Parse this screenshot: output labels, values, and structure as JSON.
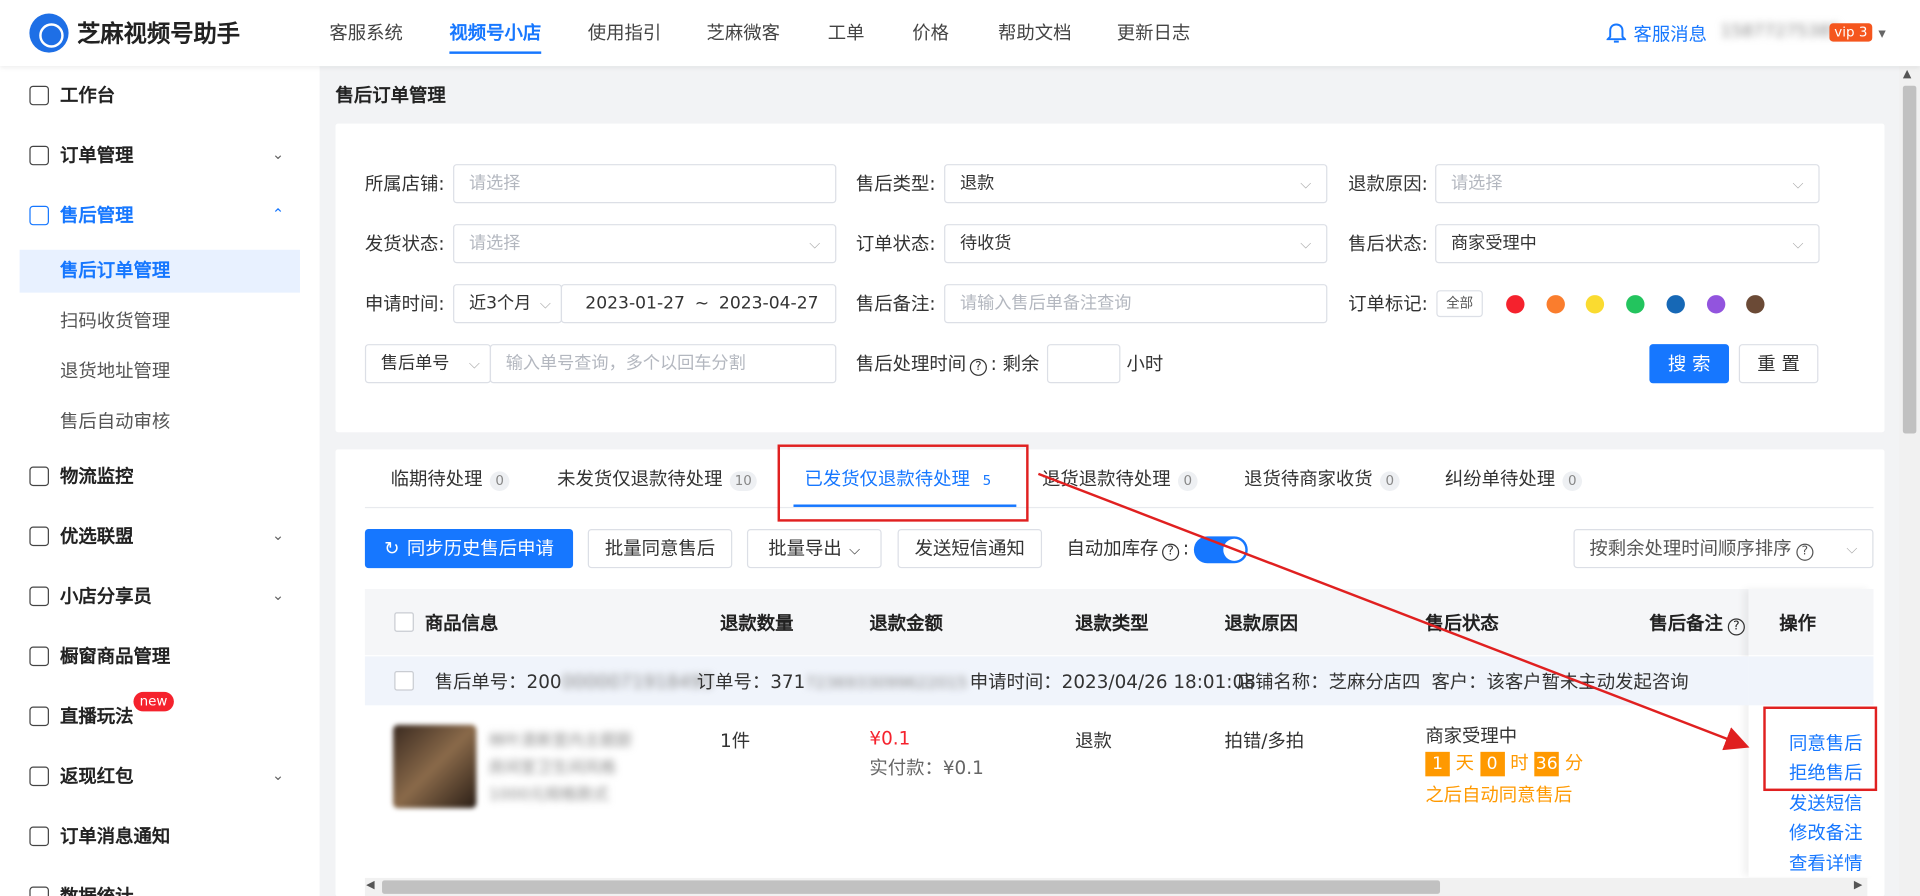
{
  "header": {
    "app_title": "芝麻视频号助手",
    "nav": [
      "客服系统",
      "视频号小店",
      "使用指引",
      "芝麻微客",
      "工单",
      "价格",
      "帮助文档",
      "更新日志"
    ],
    "messages": "客服消息",
    "vip_badge": "vip 3"
  },
  "sidebar": {
    "workbench": "工作台",
    "orders": "订单管理",
    "aftersale": "售后管理",
    "aftersale_orders": "售后订单管理",
    "scan_receive": "扫码收货管理",
    "return_address": "退货地址管理",
    "auto_review": "售后自动审核",
    "logistics": "物流监控",
    "alliance": "优选联盟",
    "sharers": "小店分享员",
    "showcase": "橱窗商品管理",
    "live": "直播玩法",
    "live_badge": "new",
    "redpacket": "返现红包",
    "order_notice": "订单消息通知",
    "stats": "数据统计"
  },
  "page_title": "售后订单管理",
  "filters": {
    "shop_label": "所属店铺:",
    "shop_placeholder": "请选择",
    "type_label": "售后类型:",
    "type_value": "退款",
    "reason_label": "退款原因:",
    "reason_placeholder": "请选择",
    "ship_label": "发货状态:",
    "ship_placeholder": "请选择",
    "order_status_label": "订单状态:",
    "order_status_value": "待收货",
    "as_status_label": "售后状态:",
    "as_status_value": "商家受理中",
    "time_label": "申请时间:",
    "time_range": "近3个月",
    "date_from": "2023-01-27",
    "date_sep": "~",
    "date_to": "2023-04-27",
    "remark_label": "售后备注:",
    "remark_placeholder": "请输入售后单备注查询",
    "mark_label": "订单标记:",
    "mark_all": "全部",
    "mark_colors": [
      "#f5222d",
      "#fa7d2d",
      "#fadb30",
      "#23c45e",
      "#1668b6",
      "#9254de",
      "#6b4a36"
    ],
    "id_type": "售后单号",
    "id_placeholder": "输入单号查询，多个以回车分割",
    "deadline_label": "售后处理时间",
    "deadline_remain": "剩余",
    "deadline_unit": "小时",
    "search": "搜 索",
    "reset": "重 置"
  },
  "tabs": [
    {
      "label": "临期待处理",
      "count": "0"
    },
    {
      "label": "未发货仅退款待处理",
      "count": "10"
    },
    {
      "label": "已发货仅退款待处理",
      "count": "5"
    },
    {
      "label": "退货退款待处理",
      "count": "0"
    },
    {
      "label": "退货待商家收货",
      "count": "0"
    },
    {
      "label": "纠纷单待处理",
      "count": "0"
    }
  ],
  "toolbar": {
    "sync": "同步历史售后申请",
    "batch_agree": "批量同意售后",
    "batch_export": "批量导出",
    "sms": "发送短信通知",
    "auto_stock": "自动加库存",
    "sort": "按剩余处理时间顺序排序"
  },
  "table": {
    "headers": [
      "商品信息",
      "退款数量",
      "退款金额",
      "退款类型",
      "退款原因",
      "售后状态",
      "售后备注",
      "操作"
    ],
    "group": {
      "as_no_label": "售后单号：",
      "as_no": "200",
      "as_no_hidden": "0000071918495",
      "order_no_label": "订单号：",
      "order_no": "371",
      "order_no_hidden": "7236933099622015",
      "apply_time": "申请时间：2023/04/26 18:01:08",
      "shop": "店铺名称：芝麻分店四",
      "customer": "客户：该客户暂未主动发起咨询"
    },
    "row": {
      "product_blur": [
        "林叶清新室内主题厨",
        "房间室卫生间风格",
        "1000元规格款式"
      ],
      "qty": "1件",
      "amount": "¥0.1",
      "paid": "实付款：¥0.1",
      "type": "退款",
      "reason": "拍错/多拍",
      "status": "商家受理中",
      "days": "1",
      "days_unit": "天",
      "hours": "0",
      "hours_unit": "时",
      "mins": "36",
      "mins_unit": "分",
      "auto_note": "之后自动同意售后",
      "actions": [
        "同意售后",
        "拒绝售后",
        "发送短信",
        "修改备注",
        "查看详情"
      ]
    }
  }
}
